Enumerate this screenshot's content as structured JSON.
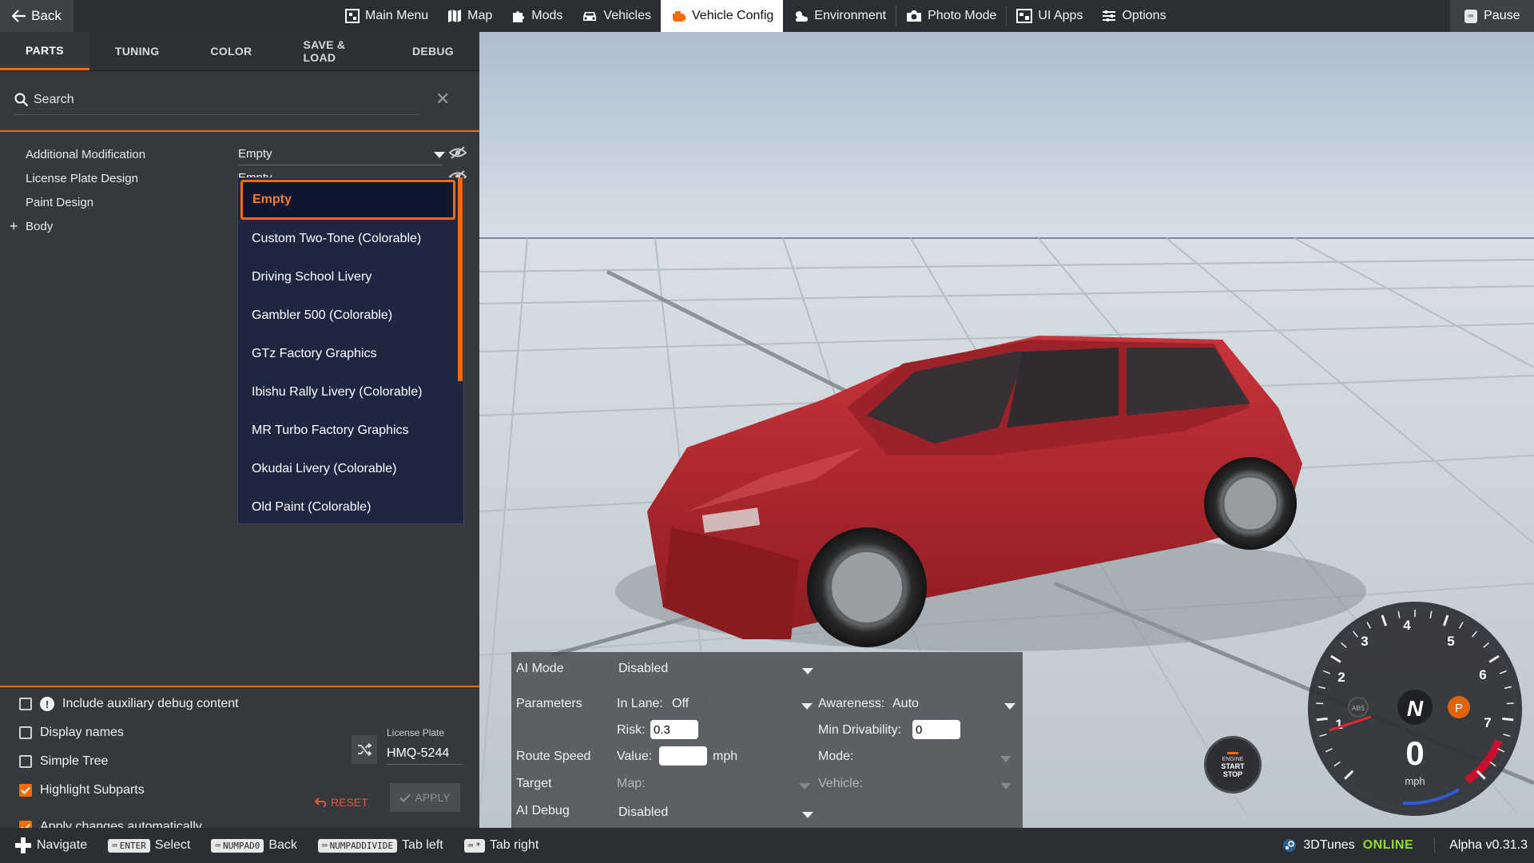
{
  "topbar": {
    "back_label": "Back",
    "nav": [
      {
        "label": "Main Menu",
        "icon": "main-menu-icon"
      },
      {
        "label": "Map",
        "icon": "map-icon"
      },
      {
        "label": "Mods",
        "icon": "puzzle-icon"
      },
      {
        "label": "Vehicles",
        "icon": "car-icon"
      },
      {
        "label": "Vehicle Config",
        "icon": "engine-icon",
        "active": true
      },
      {
        "label": "Environment",
        "icon": "weather-icon"
      },
      {
        "label": "Photo Mode",
        "icon": "camera-icon"
      },
      {
        "label": "UI Apps",
        "icon": "ui-apps-icon"
      },
      {
        "label": "Options",
        "icon": "sliders-icon"
      }
    ],
    "pause_label": "Pause"
  },
  "panel": {
    "tabs": [
      "PARTS",
      "TUNING",
      "COLOR",
      "SAVE & LOAD",
      "DEBUG"
    ],
    "active_tab": "PARTS",
    "search_placeholder": "Search",
    "tree": [
      {
        "label": "Additional Modification",
        "value": "Empty"
      },
      {
        "label": "License Plate Design",
        "value": "Empty"
      },
      {
        "label": "Paint Design",
        "value": ""
      },
      {
        "label": "Body",
        "expandable": true
      }
    ],
    "dropdown": {
      "options": [
        "Empty",
        "Custom Two-Tone (Colorable)",
        "Driving School Livery",
        "Gambler 500 (Colorable)",
        "GTz Factory Graphics",
        "Ibishu Rally Livery (Colorable)",
        "MR Turbo Factory Graphics",
        "Okudai Livery (Colorable)",
        "Old Paint (Colorable)"
      ],
      "selected": "Empty"
    },
    "options": {
      "aux_debug": {
        "label": "Include auxiliary debug content",
        "checked": false
      },
      "display_names": {
        "label": "Display names",
        "checked": false
      },
      "simple_tree": {
        "label": "Simple Tree",
        "checked": false
      },
      "highlight_subparts": {
        "label": "Highlight Subparts",
        "checked": true
      },
      "apply_auto": {
        "label": "Apply changes automatically",
        "checked": true
      }
    },
    "license_plate_label": "License Plate",
    "license_plate_value": "HMQ-5244",
    "reset_label": "RESET",
    "apply_label": "APPLY"
  },
  "ai": {
    "mode_label": "AI Mode",
    "mode_value": "Disabled",
    "parameters_label": "Parameters",
    "in_lane_label": "In Lane:",
    "in_lane_value": "Off",
    "awareness_label": "Awareness:",
    "awareness_value": "Auto",
    "risk_label": "Risk:",
    "risk_value": "0.3",
    "min_drivability_label": "Min Drivability:",
    "min_drivability_value": "0",
    "route_speed_label": "Route Speed",
    "value_label": "Value:",
    "value_value": "",
    "unit": "mph",
    "mode2_label": "Mode:",
    "target_label": "Target",
    "map_label": "Map:",
    "vehicle_label": "Vehicle:",
    "debug_label": "AI Debug",
    "debug_value": "Disabled"
  },
  "gauge": {
    "ticks": [
      "1",
      "2",
      "3",
      "4",
      "5",
      "6",
      "7"
    ],
    "gear": "N",
    "speed": "0",
    "unit": "mph",
    "abs_label": "ABS",
    "park_label": "P",
    "redline_color": "#c8102e",
    "engine_line1": "ENGINE",
    "engine_line2": "START",
    "engine_line3": "STOP"
  },
  "hints": [
    {
      "key": "",
      "label": "Navigate",
      "icon": "dpad-icon"
    },
    {
      "key": "ENTER",
      "label": "Select"
    },
    {
      "key": "NUMPAD0",
      "label": "Back"
    },
    {
      "key": "NUMPADDIVIDE",
      "label": "Tab left"
    },
    {
      "key": "*",
      "label": "Tab right"
    }
  ],
  "status": {
    "service": "3DTunes",
    "state": "ONLINE",
    "version": "Alpha v0.31.3"
  },
  "colors": {
    "accent": "#ff6a00",
    "online": "#8fdc2c",
    "car": "#b5242a"
  }
}
